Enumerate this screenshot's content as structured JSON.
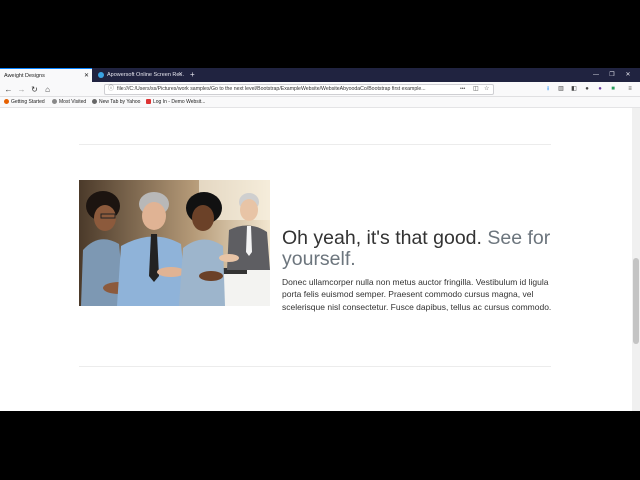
{
  "browser": {
    "tabs": [
      {
        "label": "Aweight Designs",
        "active": true
      },
      {
        "label": "Apowersoft Online Screen Re...",
        "active": false
      }
    ],
    "url": "file:///C:/Users/ss/Pictures/work samples/Go to the next level/Bootstrap/ExampleWebsite/WebsiteAbyoodaCo/Bootstrap first example...",
    "url_more": "•••",
    "bookmarks": [
      "Getting Started",
      "Most Visited",
      "New Tab by Yahoo",
      "Log In - Demo Websit..."
    ]
  },
  "feature": {
    "headline_main": "Oh yeah, it's that good.",
    "headline_muted": "See for yourself.",
    "body": "Donec ullamcorper nulla non metus auctor fringilla. Vestibulum id ligula porta felis euismod semper. Praesent commodo cursus magna, vel scelerisque nisl consectetur. Fusce dapibus, tellus ac cursus commodo."
  },
  "colors": {
    "tabbar": "#202340",
    "accent": "#0a84ff",
    "muted_text": "#6c757d",
    "body_text": "#333333"
  },
  "icons": [
    "back-icon",
    "forward-icon",
    "reload-icon",
    "home-icon",
    "info-icon",
    "pocket-icon",
    "bookmark-star-icon",
    "download-icon",
    "library-icon",
    "sidebar-icon",
    "account-icon",
    "menu-icon"
  ]
}
